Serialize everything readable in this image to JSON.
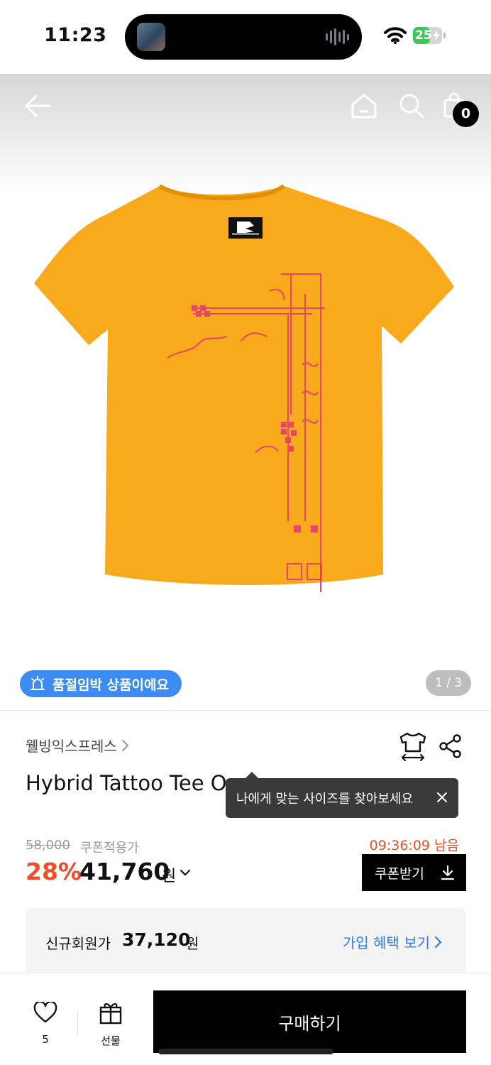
{
  "status_bar": {
    "time": "11:23",
    "battery": "25",
    "battery_level_percent": 25,
    "battery_color": "#3cc95b",
    "icons": [
      "wifi-icon",
      "battery-icon",
      "bolt-icon",
      "audio-waveform-icon"
    ]
  },
  "header": {
    "icons": [
      "back-arrow-icon",
      "home-icon",
      "search-icon",
      "shopping-bag-icon"
    ],
    "cart_count": "0"
  },
  "gallery": {
    "soldout_notice": "품절임박 상품이에요",
    "soldout_icon": "alarm-siren-icon",
    "soldout_color": "#3b8cf5",
    "page_indicator": "1 / 3",
    "garment_color": "#f8a91c",
    "graphic_color": "#e6466b"
  },
  "product": {
    "brand": "웰빙익스프레스",
    "name": "Hybrid Tattoo Tee O",
    "tooltip": "나에게 맞는 사이즈를 찾아보세요",
    "icons": [
      "size-guide-icon",
      "share-icon",
      "close-icon",
      "chevron-right-icon"
    ]
  },
  "pricing": {
    "original_price": "58,000",
    "coupon_label": "쿠폰적용가",
    "timer": "09:36:09 남음",
    "discount": "28%",
    "sale_price": "41,760",
    "currency": "원",
    "coupon_button": "쿠폰받기",
    "accent_color": "#ef4d26"
  },
  "member": {
    "label": "신규회원가",
    "price": "37,120",
    "currency": "원",
    "signup_link": "가입 혜택 보기",
    "link_color": "#2f7bf0"
  },
  "bottom_bar": {
    "like_count": "5",
    "gift_label": "선물",
    "buy_label": "구매하기",
    "icons": [
      "heart-icon",
      "gift-icon"
    ]
  }
}
